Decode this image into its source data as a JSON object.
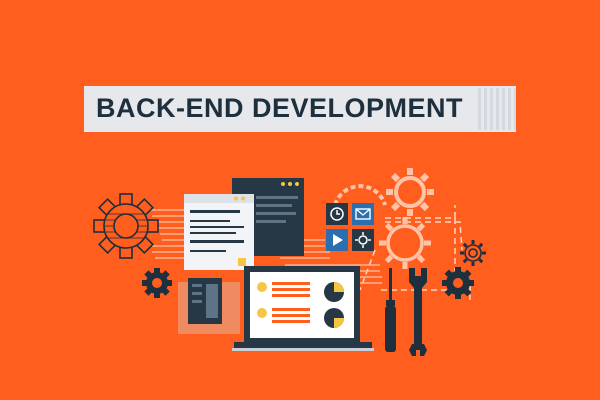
{
  "banner": {
    "title": "BACK-END DEVELOPMENT"
  },
  "colors": {
    "background": "#ff5e1f",
    "banner": "#e6e8ec",
    "title_text": "#1e2f3d",
    "dark": "#263846",
    "accent_orange": "#ff5e1f",
    "accent_yellow": "#f6c543",
    "accent_blue": "#2a6fb0"
  },
  "icons": [
    "gear-icon",
    "wrench-icon",
    "screwdriver-icon",
    "clock-icon",
    "mail-icon",
    "play-icon",
    "settings-icon",
    "laptop-icon",
    "browser-window-icon",
    "code-window-icon",
    "pie-chart-icon",
    "server-icon"
  ]
}
